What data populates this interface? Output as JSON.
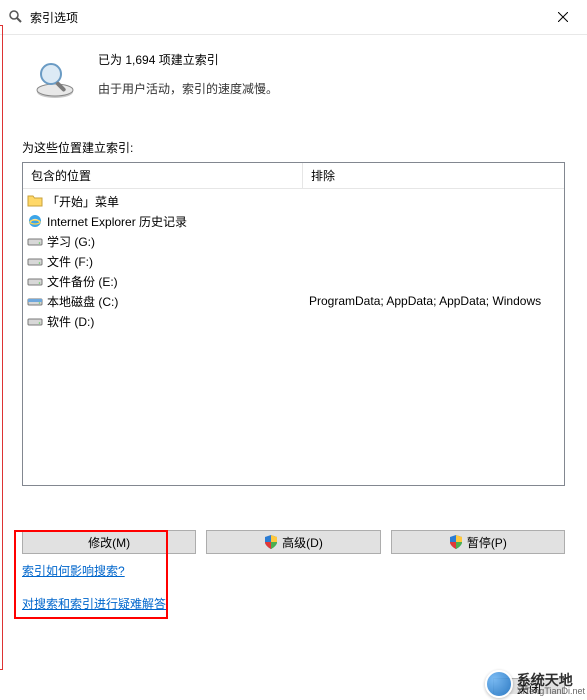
{
  "title": "索引选项",
  "header": {
    "status": "已为 1,694 项建立索引",
    "substatus": "由于用户活动，索引的速度减慢。"
  },
  "locations_label": "为这些位置建立索引:",
  "columns": {
    "included": "包含的位置",
    "excluded": "排除"
  },
  "items": [
    {
      "icon": "folder",
      "name": "「开始」菜单",
      "excluded": ""
    },
    {
      "icon": "ie",
      "name": "Internet Explorer 历史记录",
      "excluded": ""
    },
    {
      "icon": "drive",
      "name": "学习 (G:)",
      "excluded": ""
    },
    {
      "icon": "drive",
      "name": "文件 (F:)",
      "excluded": ""
    },
    {
      "icon": "drive",
      "name": "文件备份 (E:)",
      "excluded": ""
    },
    {
      "icon": "cdrive",
      "name": "本地磁盘 (C:)",
      "excluded": "ProgramData; AppData; AppData; Windows"
    },
    {
      "icon": "drive",
      "name": "软件 (D:)",
      "excluded": ""
    }
  ],
  "buttons": {
    "modify": "修改(M)",
    "advanced": "高级(D)",
    "pause": "暂停(P)",
    "close": "关闭"
  },
  "links": {
    "how_affects_search": "索引如何影响搜索?",
    "troubleshoot": "对搜索和索引进行疑难解答"
  },
  "watermark": {
    "cn": "系统天地",
    "en": "XiTongTianDi.net"
  }
}
